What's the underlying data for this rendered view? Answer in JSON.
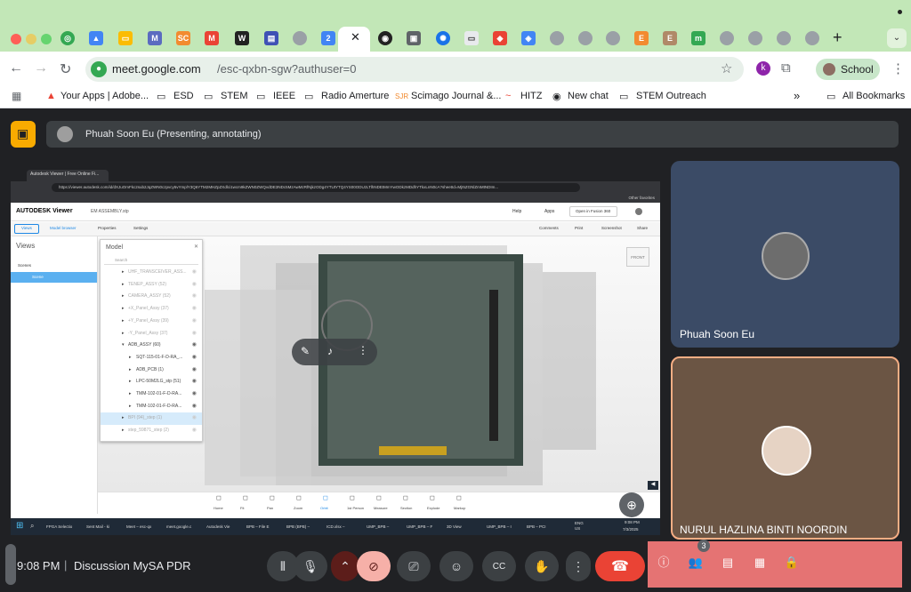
{
  "browser": {
    "url_host": "meet.google.com",
    "url_path": "/esc-qxbn-sgw?authuser=0",
    "profile_label": "School",
    "profile_initial": "k",
    "active_tab_close": "✕",
    "new_tab": "+",
    "bookmarks": [
      {
        "label": "Your Apps | Adobe..."
      },
      {
        "label": "ESD"
      },
      {
        "label": "STEM"
      },
      {
        "label": "IEEE"
      },
      {
        "label": "Radio Amerture"
      },
      {
        "label": "Scimago Journal &..."
      },
      {
        "label": "HITZ"
      },
      {
        "label": "New chat"
      },
      {
        "label": "STEM Outreach"
      },
      {
        "label": "All Bookmarks"
      }
    ],
    "bookmark_more": "»"
  },
  "meet": {
    "presenter_label": "Phuah Soon Eu (Presenting, annotating)",
    "time": "9:08 PM",
    "separator": "|",
    "meeting_title": "Discussion MySA PDR",
    "people_count": "3",
    "participants": [
      {
        "name": "Phuah Soon Eu"
      },
      {
        "name": "NURUL HAZLINA BINTI NOORDIN"
      }
    ]
  },
  "shared_screen": {
    "tab_title": "Autodesk Viewer | Free Online Fi...",
    "url": "https://viewer.autodesk.com/id/dXJuOmFkc2sub2JqZWN0czpvcy5vYmplY3Q6YTM2MHZpZXdlci1wcm9kZWN0ZWQvdDE3NDc5MzAwMzRfNjkzODg4YTUtYTQ4YS00ODUzLTlhNDEtMmYwODkzMDdhYTkxLnN0cA?sheetId=MjI5ZGNlZmMtNDIm...",
    "other_favorites": "Other favorites",
    "app_name": "AUTODESK Viewer",
    "file_name": "EM ASSEMBLY.stp",
    "help": "Help",
    "apps": "Apps",
    "open_fusion": "Open in Fusion 360",
    "toolbar": {
      "views": "Views",
      "model_browser": "Model browser",
      "properties": "Properties",
      "settings": "Settings",
      "comments": "Comments",
      "print": "Print",
      "screenshot": "Screenshot",
      "share": "Share"
    },
    "views_title": "Views",
    "scenes_label": "Scenes",
    "scene_item": "Scene",
    "model_title": "Model",
    "search_placeholder": "Search",
    "tree": [
      {
        "label": "UHF_TRANSCEIVER_ASS...",
        "dim": true,
        "indent": 1
      },
      {
        "label": "TENEP_ASSY (52)",
        "dim": true,
        "indent": 1
      },
      {
        "label": "CAMERA_ASSY (52)",
        "dim": true,
        "indent": 1
      },
      {
        "label": "+X_Panel_Assy (37)",
        "dim": true,
        "indent": 1
      },
      {
        "label": "+Y_Panel_Assy (39)",
        "dim": true,
        "indent": 1
      },
      {
        "label": "-Y_Panel_Assy (37)",
        "dim": true,
        "indent": 1
      },
      {
        "label": "ADB_ASSY (60)",
        "dim": false,
        "indent": 1,
        "expanded": true
      },
      {
        "label": "SQT-115-01-F-D-RA_...",
        "dim": false,
        "indent": 2
      },
      {
        "label": "ADB_PCB (1)",
        "dim": false,
        "indent": 2
      },
      {
        "label": "LPC-50M2LG_stp (51)",
        "dim": false,
        "indent": 2
      },
      {
        "label": "TMM-102-01-F-D-RA...",
        "dim": false,
        "indent": 2
      },
      {
        "label": "TMM-102-01-F-D-RA...",
        "dim": false,
        "indent": 2
      },
      {
        "label": "BPI (94)_step (1)",
        "dim": true,
        "indent": 1,
        "selected": true
      },
      {
        "label": "step_59871_step (2)",
        "dim": true,
        "indent": 1
      }
    ],
    "viewcube_label": "FRONT",
    "bottom_tools": [
      "Home",
      "Fit",
      "Pan",
      "Zoom",
      "Orbit",
      "1st Person",
      "Measure",
      "Section",
      "Explode",
      "Markup"
    ],
    "taskbar": [
      "FPGA Selectio",
      "Sent Mail - ki",
      "Meet – esc-qx",
      "meet.google.c",
      "Autodesk Vie",
      "BPB – File E",
      "BPB (BPB) –",
      "ICD.xlsx –",
      "UMP_BPB –",
      "UMP_BPB – F",
      "3D View",
      "UMP_BPB – I",
      "BPB – PCI"
    ],
    "taskbar_lang": "ENG US",
    "taskbar_time": "9:08 PM",
    "taskbar_date": "7/3/2025"
  },
  "colors": {
    "tabstrip": "#c2e7b7",
    "meet_bg": "#202124",
    "end_call": "#ea4335",
    "side_panel": "#e57373",
    "present_accent": "#f9ab00"
  }
}
